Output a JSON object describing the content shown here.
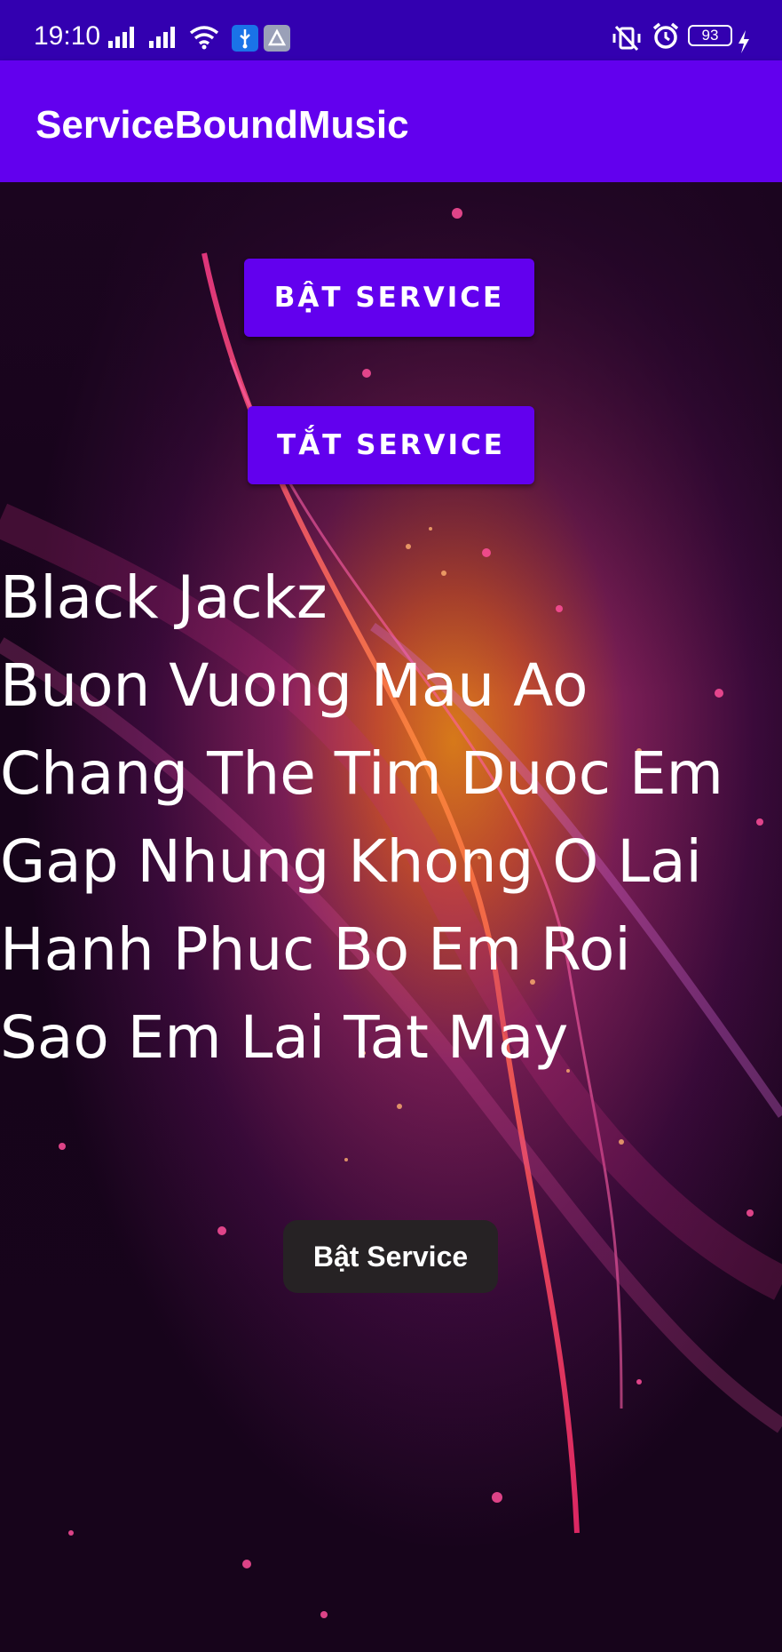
{
  "status_bar": {
    "time": "19:10",
    "battery_level": "93",
    "icons": [
      "signal-icon",
      "signal-icon",
      "wifi-icon",
      "usb-debug-icon",
      "nearby-share-icon",
      "vibrate-mute-icon",
      "alarm-icon",
      "battery-icon",
      "charging-icon"
    ]
  },
  "app_bar": {
    "title": "ServiceBoundMusic"
  },
  "buttons": {
    "start_label": "BẬT SERVICE",
    "stop_label": "TẮT SERVICE"
  },
  "lyrics": [
    "Black Jackz",
    "Buon Vuong Mau Ao",
    "Chang The Tim Duoc Em",
    "Gap Nhung Khong O Lai",
    "Hanh Phuc Bo Em Roi",
    "Sao Em Lai Tat May"
  ],
  "toast": {
    "message": "Bật Service"
  },
  "colors": {
    "status_bar": "#3300b0",
    "app_bar": "#6200ee",
    "button": "#6200ee",
    "toast": "#262224"
  }
}
